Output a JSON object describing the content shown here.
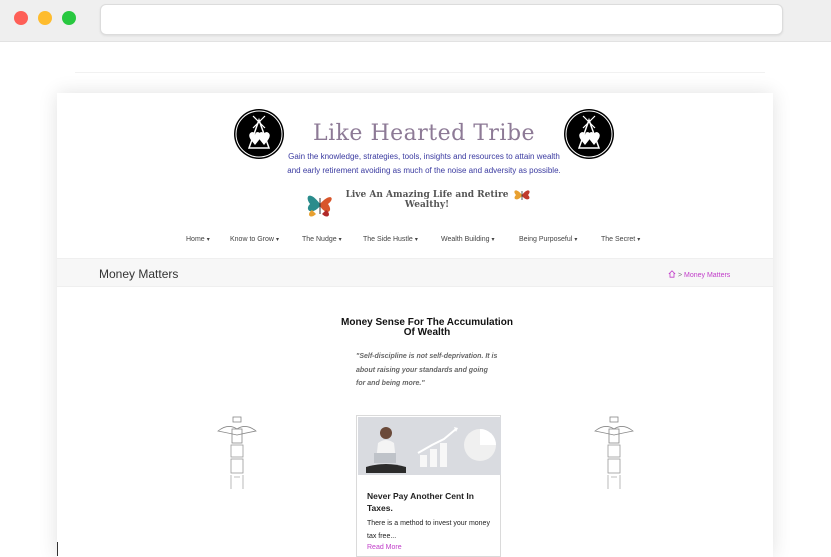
{
  "site": {
    "title": "Like Hearted Tribe",
    "tagline": "Gain the knowledge, strategies, tools, insights and resources to attain wealth and early retirement avoiding as much of the noise and adversity as possible.",
    "slogan": "Live An Amazing Life and Retire Wealthy!"
  },
  "nav": {
    "items": [
      {
        "label": "Home"
      },
      {
        "label": "Know to Grow"
      },
      {
        "label": "The Nudge"
      },
      {
        "label": "The Side Hustle"
      },
      {
        "label": "Wealth Building"
      },
      {
        "label": "Being Purposeful"
      },
      {
        "label": "The Secret"
      }
    ]
  },
  "page": {
    "heading": "Money Matters",
    "breadcrumb_current": "Money Matters"
  },
  "section": {
    "title": "Money Sense For The Accumulation Of Wealth",
    "quote": "\"Self-discipline is not self-deprivation. It is about raising your standards and going for and being more.\""
  },
  "card": {
    "title": "Never Pay Another Cent In Taxes.",
    "excerpt": "There is a method to invest your money tax free...",
    "link": "Read More"
  },
  "colors": {
    "title": "#8d7a96",
    "tagline": "#3a3aa0",
    "accent": "#c13cc9"
  },
  "icons": [
    "tribe-logo-icon",
    "butterfly-icon",
    "chevron-down-icon",
    "home-icon",
    "totem-icon"
  ]
}
